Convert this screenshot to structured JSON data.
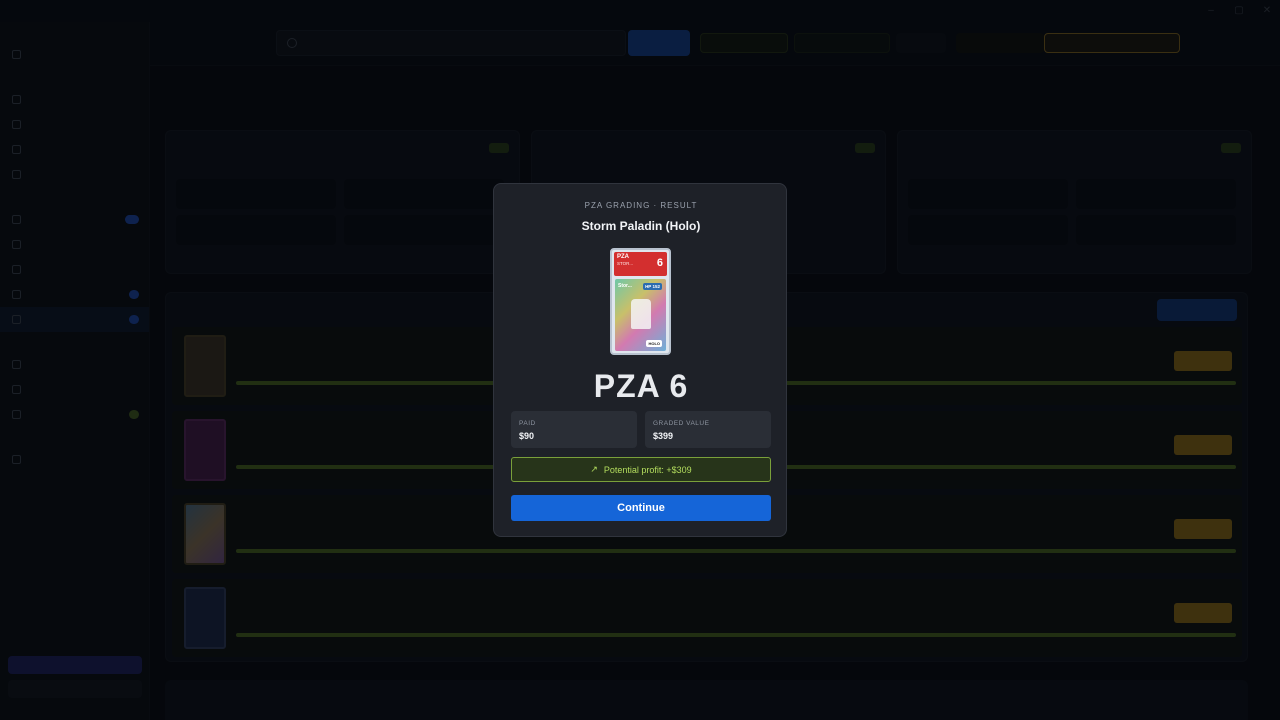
{
  "modal": {
    "caption": "PZA GRADING · RESULT",
    "card_name": "Storm Paladin (Holo)",
    "slab": {
      "brand": "PZA",
      "short_name": "STOR...",
      "grade_num": "6",
      "art_name": "Stor...",
      "hp": "HP 152",
      "holo": "HOLO"
    },
    "grade_text": "PZA 6",
    "paid_label": "PAID",
    "paid_value": "$90",
    "graded_label": "GRADED VALUE",
    "graded_value": "$399",
    "profit_text": "Potential profit: +$309",
    "continue_label": "Continue"
  }
}
